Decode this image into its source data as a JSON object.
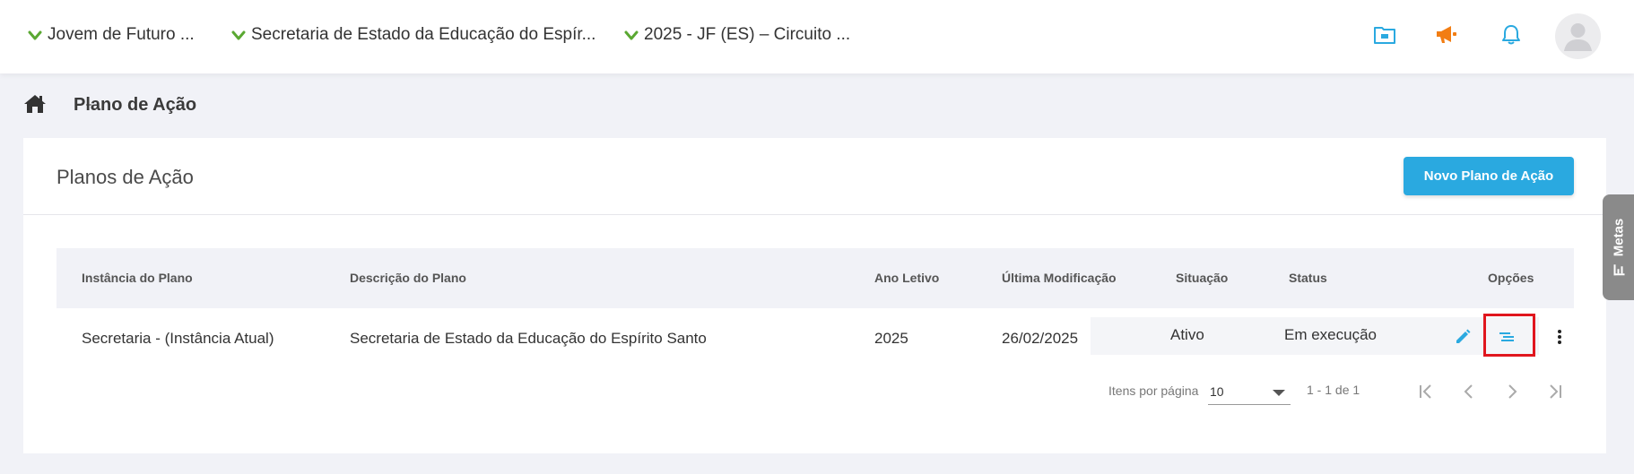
{
  "topbar": {
    "context": [
      {
        "label": "Jovem de Futuro ...",
        "icon": "chevron-down-icon"
      },
      {
        "label": "Secretaria de Estado da Educação do Espír...",
        "icon": "chevron-down-icon"
      },
      {
        "label": "2025 - JF (ES) – Circuito ...",
        "icon": "chevron-down-icon"
      }
    ],
    "icons": [
      "folder-icon",
      "megaphone-icon",
      "bell-icon",
      "user-avatar-icon"
    ],
    "colors": {
      "chevron": "#5aa832",
      "folder": "#2aa9e0",
      "megaphone": "#f27d13",
      "bell": "#2aa9e0"
    }
  },
  "breadcrumb": {
    "home_icon": "home-icon",
    "title": "Plano de Ação"
  },
  "card": {
    "title": "Planos de Ação",
    "new_button": "Novo Plano de Ação"
  },
  "table": {
    "columns": [
      "Instância do Plano",
      "Descrição do Plano",
      "Ano Letivo",
      "Última Modificação",
      "Situação",
      "Status",
      "Opções"
    ],
    "rows": [
      {
        "instancia": "Secretaria - (Instância Atual)",
        "descricao": "Secretaria de Estado da Educação do Espírito Santo",
        "ano": "2025",
        "modificacao": "26/02/2025",
        "situacao": "Ativo",
        "status": "Em execução",
        "options": [
          "edit-icon",
          "list-icon",
          "more-vertical-icon"
        ]
      }
    ]
  },
  "pagination": {
    "items_label": "Itens por página",
    "page_size": "10",
    "range": "1 - 1 de 1"
  },
  "side_tab": {
    "label": "Metas",
    "icon": "bar-chart-icon"
  },
  "colors": {
    "accent": "#2aa9e0",
    "highlight": "#e0161e",
    "background": "#f1f2f7"
  }
}
